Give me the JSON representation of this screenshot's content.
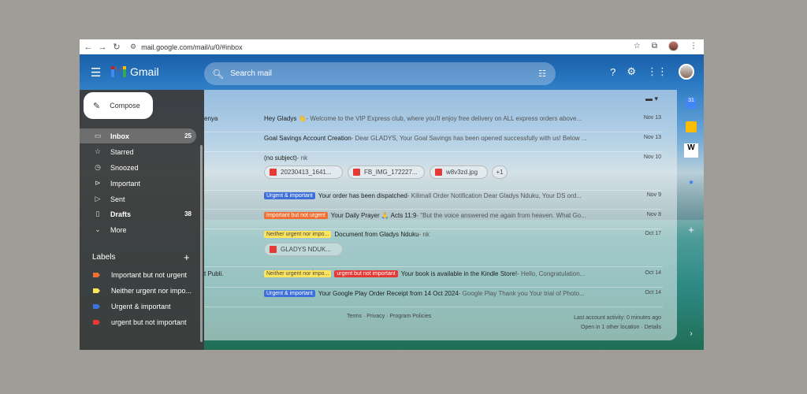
{
  "browser": {
    "url": "mail.google.com/mail/u/0/#inbox"
  },
  "app": {
    "name": "Gmail"
  },
  "search": {
    "placeholder": "Search mail"
  },
  "compose": {
    "label": "Compose"
  },
  "nav": [
    {
      "label": "Inbox",
      "count": "25",
      "icon": "inbox-icon"
    },
    {
      "label": "Starred",
      "count": "",
      "icon": "star-icon"
    },
    {
      "label": "Snoozed",
      "count": "",
      "icon": "clock-icon"
    },
    {
      "label": "Important",
      "count": "",
      "icon": "important-icon"
    },
    {
      "label": "Sent",
      "count": "",
      "icon": "send-icon"
    },
    {
      "label": "Drafts",
      "count": "38",
      "icon": "draft-icon"
    },
    {
      "label": "More",
      "count": "",
      "icon": "chevron-down-icon"
    }
  ],
  "labels_heading": "Labels",
  "labels": [
    {
      "label": "Important but not urgent",
      "color": "#f07033"
    },
    {
      "label": "Neither urgent nor impo...",
      "color": "#ffe55c"
    },
    {
      "label": "Urgent & important",
      "color": "#3f6fd8"
    },
    {
      "label": "urgent but not important",
      "color": "#e53935"
    }
  ],
  "emails": [
    {
      "sender": "enya",
      "badges": [],
      "subject": "Hey Gladys 👋",
      "snippet": " - Welcome to the VIP Express club, where you'll enjoy free delivery on ALL express orders above...",
      "date": "Nov 13"
    },
    {
      "sender": "",
      "badges": [],
      "subject": "Goal Savings Account Creation",
      "snippet": " - Dear GLADYS, Your Goal Savings has been opened successfully with us! Below ...",
      "date": "Nov 13"
    },
    {
      "sender": "",
      "badges": [],
      "subject": "(no subject)",
      "snippet": " - nk",
      "date": "Nov 10"
    },
    {
      "sender": "",
      "badges": [
        {
          "text": "Urgent & important",
          "style": "blue"
        }
      ],
      "subject": "Your order has been dispatched",
      "snippet": " - Kilimall Order Notification Dear Gladys Nduku, Your DS ord...",
      "date": "Nov 9"
    },
    {
      "sender": "",
      "badges": [
        {
          "text": "Important but not urgent",
          "style": "orange"
        }
      ],
      "subject": "Your Daily Prayer 🙏 Acts 11:9",
      "snippet": " - \"But the voice answered me again from heaven. What Go...",
      "date": "Nov 8"
    },
    {
      "sender": "",
      "badges": [
        {
          "text": "Neither urgent nor impo...",
          "style": "yellow"
        }
      ],
      "subject": "Document from Gladys Nduku",
      "snippet": " - nk",
      "date": "Oct 17"
    },
    {
      "sender": "t Publi.",
      "badges": [
        {
          "text": "Neither urgent nor impo...",
          "style": "yellow"
        },
        {
          "text": "urgent but not important",
          "style": "red"
        }
      ],
      "subject": "Your book is available in the Kindle Store!",
      "snippet": " - Hello, Congratulation...",
      "date": "Oct 14"
    },
    {
      "sender": "",
      "badges": [
        {
          "text": "Urgent & important",
          "style": "blue"
        }
      ],
      "subject": "Your Google Play Order Receipt from 14 Oct 2024",
      "snippet": " - Google Play Thank you Your trial of Photo...",
      "date": "Oct 14"
    }
  ],
  "attachments_row3": [
    "20230413_1641...",
    "FB_IMG_172227...",
    "w8v3zd.jpg",
    "+1"
  ],
  "attachments_row6": [
    "GLADYS NDUK..."
  ],
  "footer": {
    "links": "Terms · Privacy · Program Policies",
    "activity": "Last account activity: 0 minutes ago",
    "details": "Open in 1 other location · Details"
  }
}
